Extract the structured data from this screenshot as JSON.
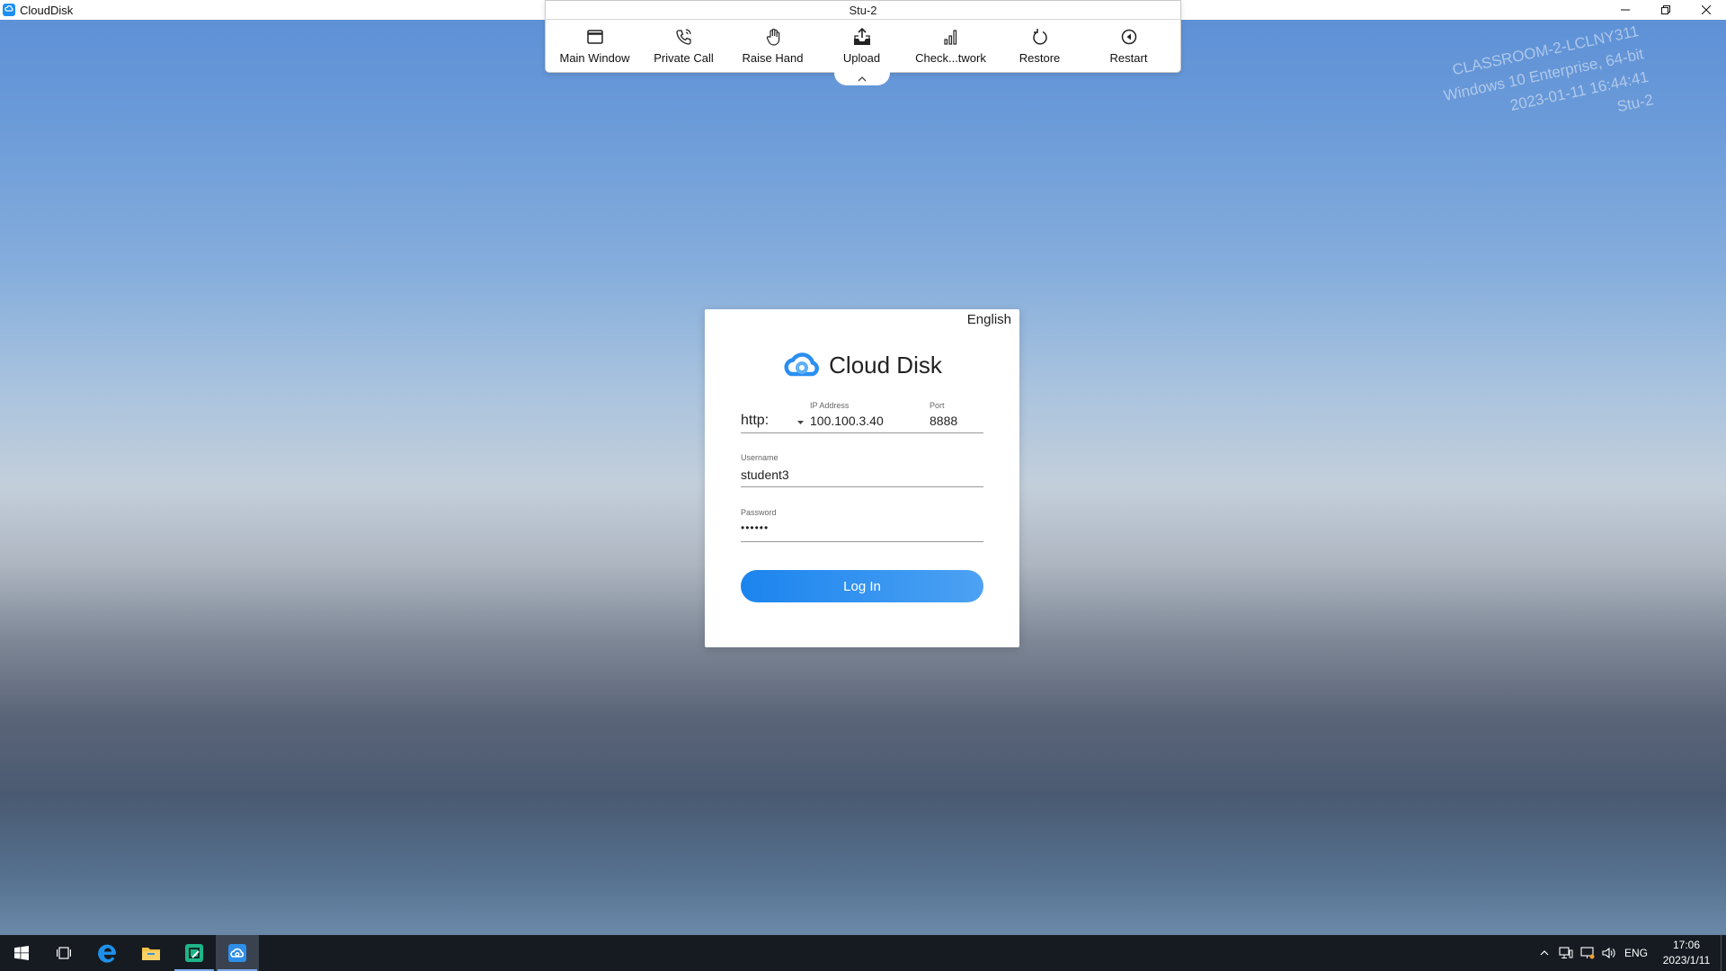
{
  "window": {
    "title": "CloudDisk",
    "app_icon": "clouddisk-icon"
  },
  "toolbar": {
    "title": "Stu-2",
    "items": [
      {
        "label": "Main Window",
        "icon": "window-icon"
      },
      {
        "label": "Private Call",
        "icon": "phone-icon"
      },
      {
        "label": "Raise Hand",
        "icon": "hand-icon"
      },
      {
        "label": "Upload",
        "icon": "upload-icon"
      },
      {
        "label": "Check...twork",
        "icon": "signal-bars-icon"
      },
      {
        "label": "Restore",
        "icon": "refresh-icon"
      },
      {
        "label": "Restart",
        "icon": "restart-icon"
      }
    ]
  },
  "watermark": {
    "line1": "CLASSROOM-2-LCLNY311",
    "line2": "Windows 10 Enterprise, 64-bit",
    "line3": "2023-01-11 16:44:41",
    "line4": "Stu-2"
  },
  "login": {
    "language": "English",
    "brand": "Cloud Disk",
    "protocol": "http:",
    "ip_label": "IP Address",
    "ip_value": "100.100.3.40",
    "port_label": "Port",
    "port_value": "8888",
    "username_label": "Username",
    "username_value": "student3",
    "password_label": "Password",
    "password_value": "••••••",
    "login_button": "Log In"
  },
  "colors": {
    "accent": "#1e8ff0",
    "taskbar": "#161b22"
  },
  "taskbar": {
    "tray_language": "ENG",
    "time": "17:06",
    "date": "2023/1/11"
  }
}
